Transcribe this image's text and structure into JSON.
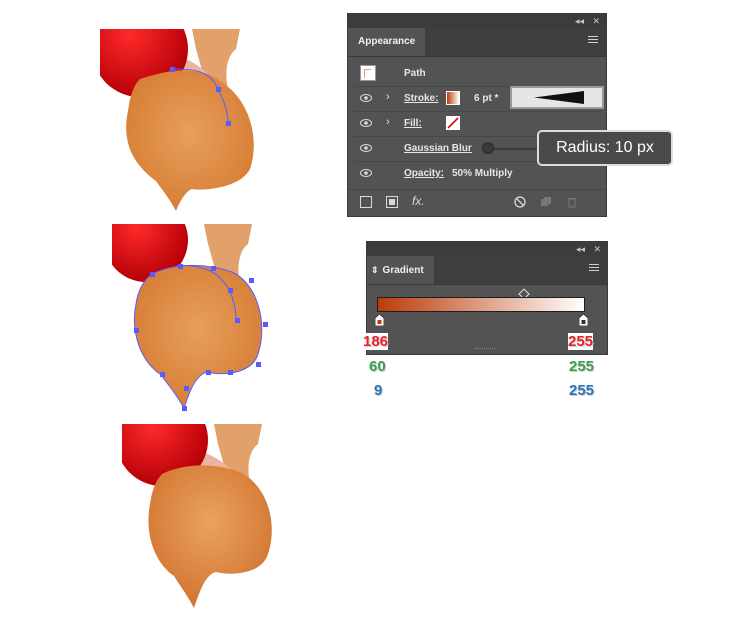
{
  "appearance_panel": {
    "tab_label": "Appearance",
    "topbar_collapse": "◂◂",
    "topbar_close": "✕",
    "path_label": "Path",
    "stroke": {
      "label": "Stroke:",
      "value": "6 pt *",
      "color": "#ba3c09"
    },
    "fill": {
      "label": "Fill:"
    },
    "effect": {
      "label": "Gaussian Blur"
    },
    "opacity": {
      "label": "Opacity:",
      "value": "50% Multiply"
    },
    "footer_fx": "fx."
  },
  "tooltip": {
    "text": "Radius: 10 px"
  },
  "gradient_panel": {
    "tab_label": "Gradient",
    "tab_icon": "⇕",
    "topbar_collapse": "◂◂",
    "topbar_close": "✕",
    "start_color": "#ba3c09",
    "end_color": "#ffffff"
  },
  "gradient_values": {
    "left": {
      "r": "186",
      "g": "60",
      "b": "9"
    },
    "right": {
      "r": "255",
      "g": "255",
      "b": "255"
    }
  },
  "colors": {
    "ball_red": "#e0000b",
    "body_orange": "#e39449",
    "neck": "#e2a06b",
    "anchor": "#5a5bff"
  }
}
